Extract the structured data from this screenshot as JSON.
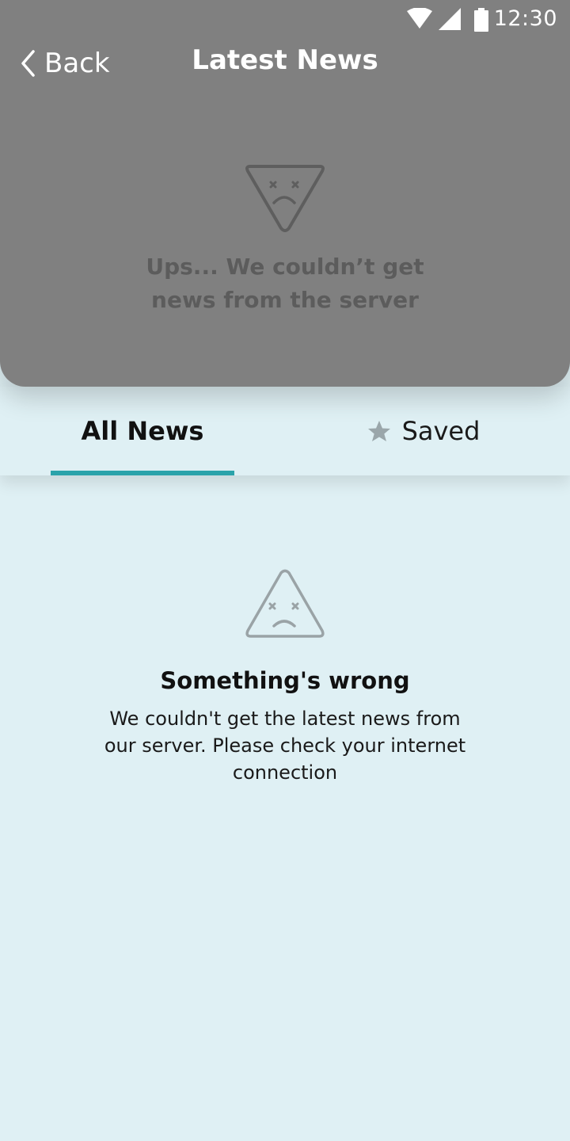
{
  "status_bar": {
    "time": "12:30",
    "icons": [
      "wifi-icon",
      "signal-icon",
      "battery-icon"
    ]
  },
  "app_bar": {
    "back_label": "Back",
    "title": "Latest News"
  },
  "header_error": {
    "icon": "sad-face-triangle-icon",
    "message": "Ups... We couldn’t get news from the server"
  },
  "tabs": [
    {
      "label": "All News",
      "selected": true
    },
    {
      "label": "Saved",
      "icon": "star-icon",
      "selected": false
    }
  ],
  "error_state": {
    "icon": "sad-face-triangle-icon",
    "title": "Something's wrong",
    "message": "We couldn't get the latest news from our server. Please check your internet connection"
  },
  "colors": {
    "header_background": "#808080",
    "page_background": "#dff0f4",
    "tab_indicator": "#2aa3aa",
    "dimmed_text": "#5c5c5c"
  }
}
